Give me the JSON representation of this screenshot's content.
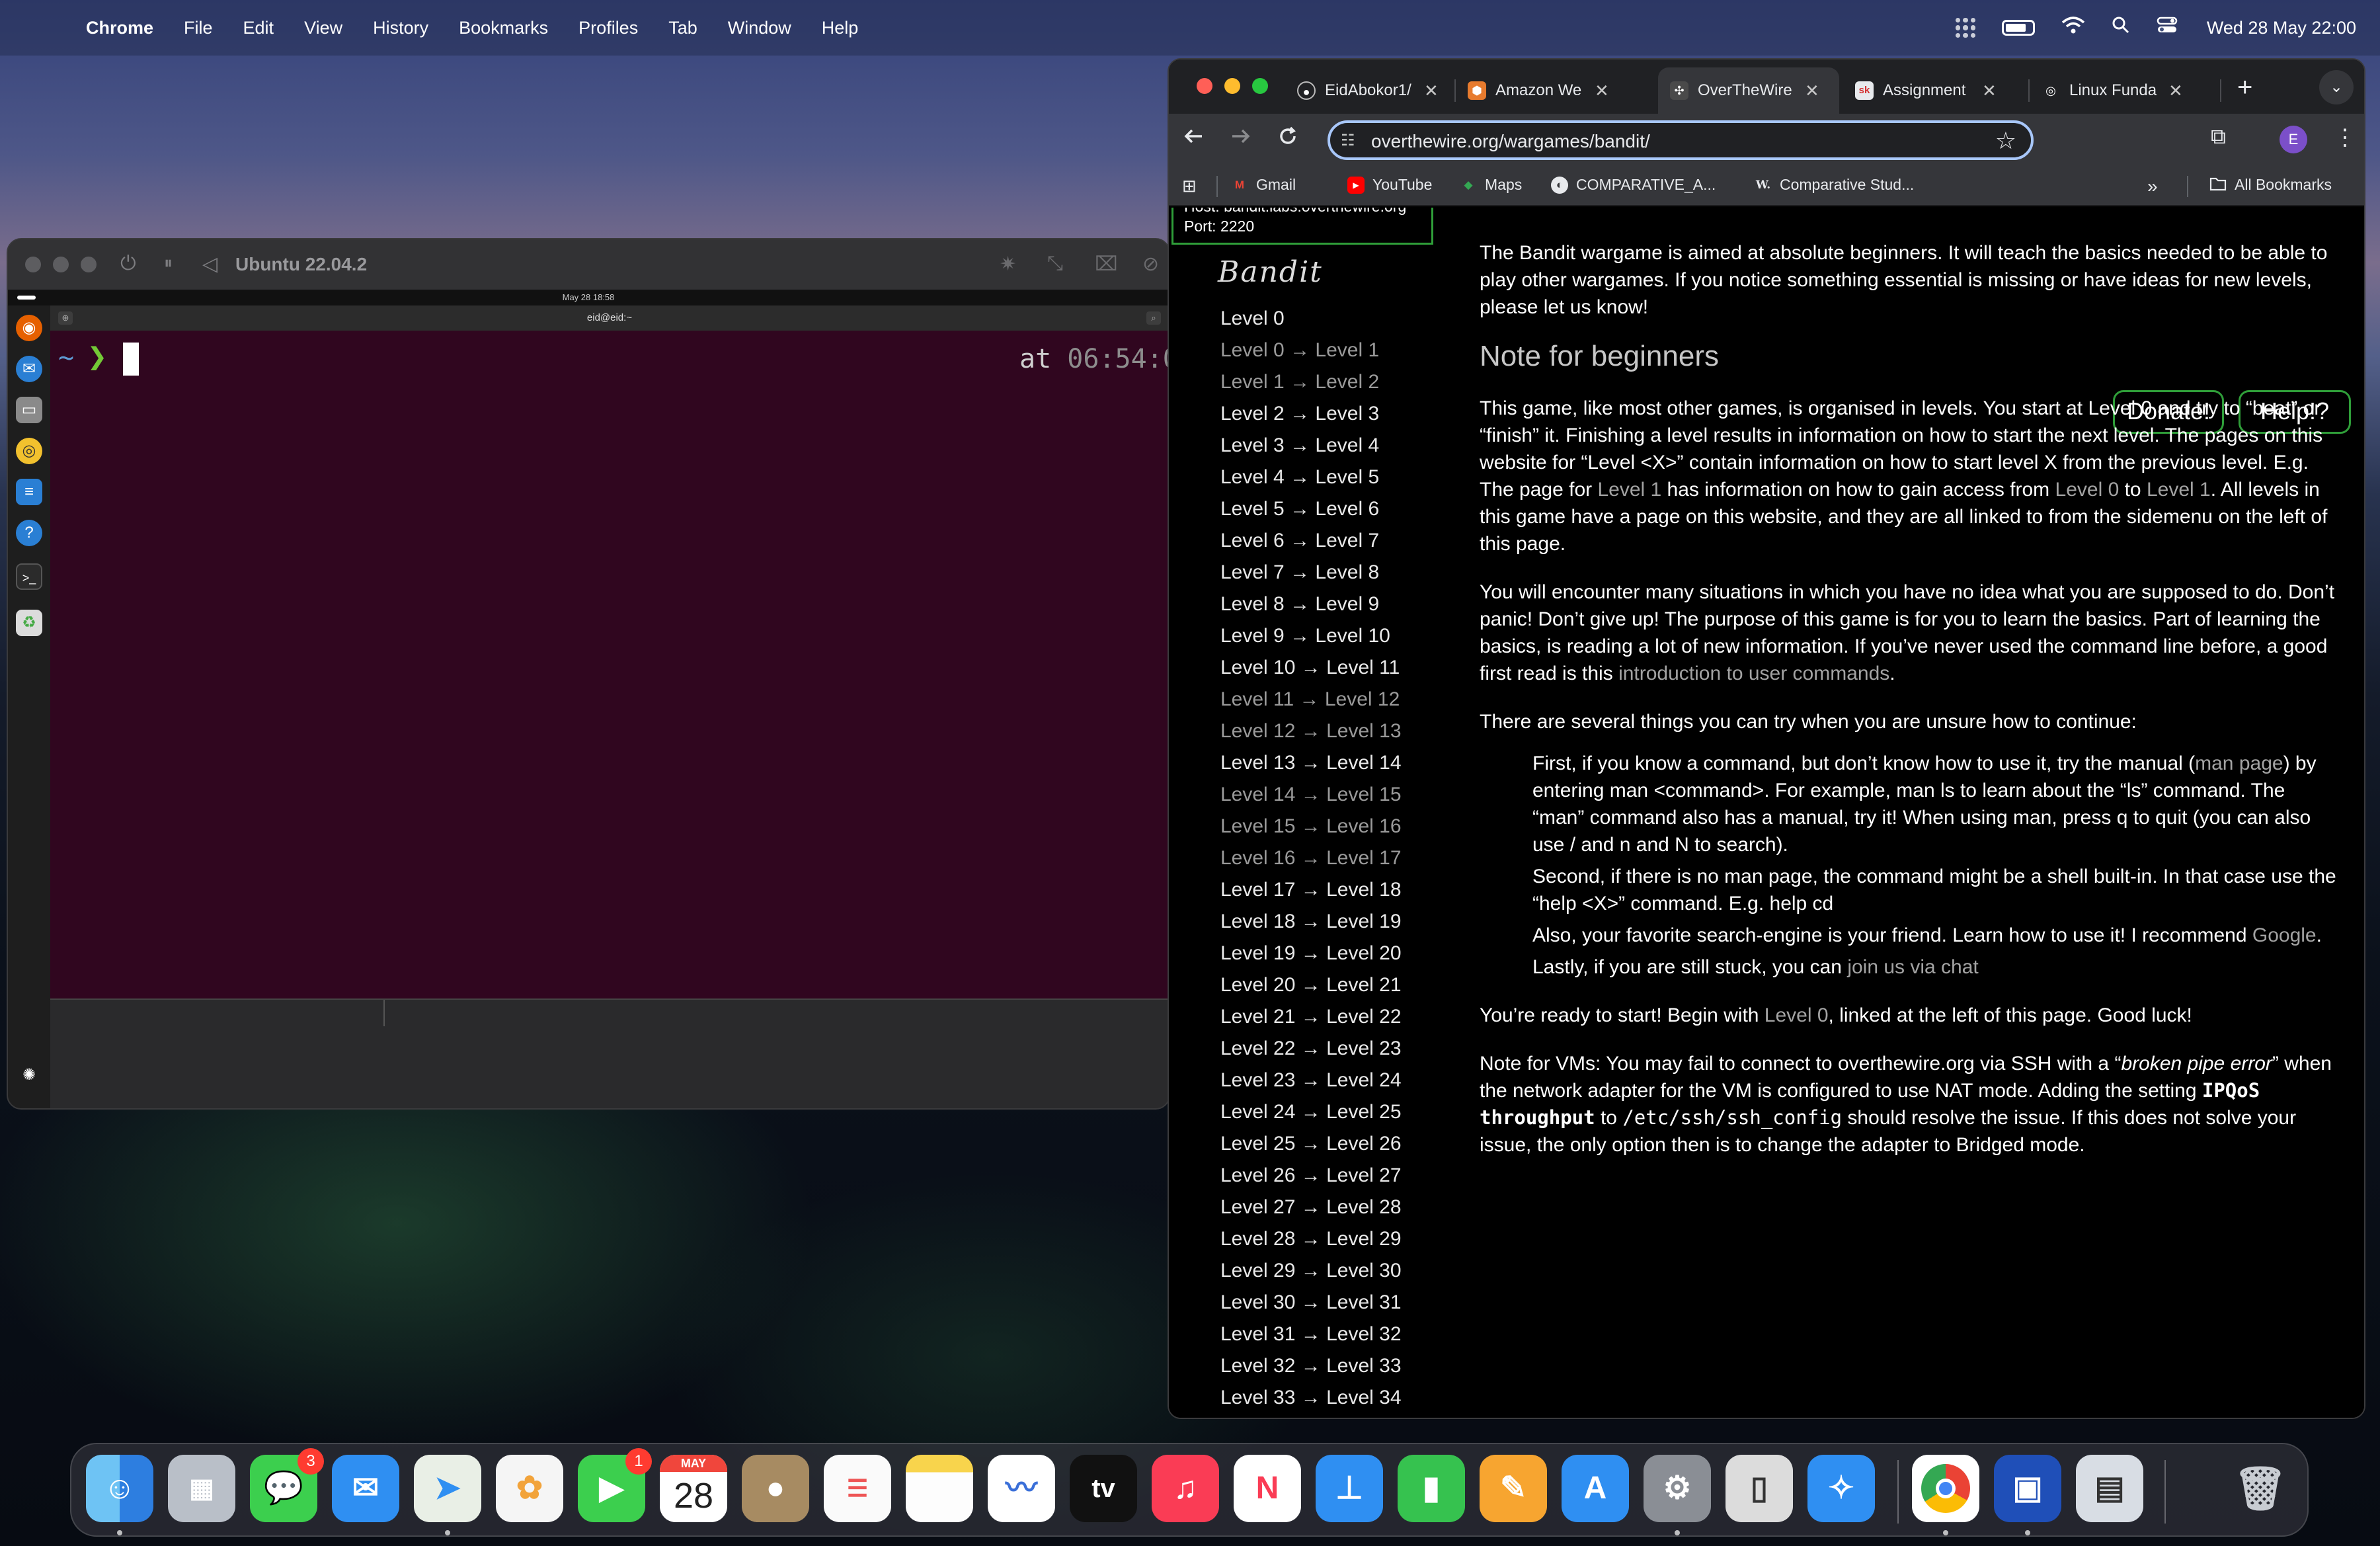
{
  "menubar": {
    "app_name": "Chrome",
    "menus": [
      "File",
      "Edit",
      "View",
      "History",
      "Bookmarks",
      "Profiles",
      "Tab",
      "Window",
      "Help"
    ],
    "clock": "Wed 28 May  22:00"
  },
  "vm": {
    "title": "Ubuntu 22.04.2",
    "ubuntu_clock": "May 28  18:58",
    "terminal_title": "eid@eid:~",
    "prompt_tilde": "~",
    "prompt_arrow": "❯",
    "right_prompt_at": "at",
    "right_prompt_time": "06:54:0"
  },
  "chrome": {
    "tabs": [
      {
        "label": "EidAbokor1/",
        "icon_name": "github-icon"
      },
      {
        "label": "Amazon We",
        "icon_name": "aws-icon"
      },
      {
        "label": "OverTheWire",
        "icon_name": "overthewire-icon"
      },
      {
        "label": "Assignment",
        "icon_name": "assignment-sk-icon"
      },
      {
        "label": "Linux Funda",
        "icon_name": "globe-icon"
      }
    ],
    "url": "overthewire.org/wargames/bandit/",
    "profile_initial": "E",
    "bookmarks": [
      {
        "label": "Gmail",
        "icon_name": "gmail-icon"
      },
      {
        "label": "YouTube",
        "icon_name": "youtube-icon"
      },
      {
        "label": "Maps",
        "icon_name": "maps-icon"
      },
      {
        "label": "COMPARATIVE_A...",
        "icon_name": "globe-icon"
      },
      {
        "label": "Comparative Stud...",
        "icon_name": "w-icon"
      }
    ],
    "all_bookmarks": "All Bookmarks"
  },
  "page": {
    "conn_host": "Host: bandit.labs.overthewire.org",
    "conn_port": "Port: 2220",
    "logo_text": "Bandit",
    "sidemenu": [
      "Level 0",
      "Level 0 → Level 1",
      "Level 1 → Level 2",
      "Level 2 → Level 3",
      "Level 3 → Level 4",
      "Level 4 → Level 5",
      "Level 5 → Level 6",
      "Level 6 → Level 7",
      "Level 7 → Level 8",
      "Level 8 → Level 9",
      "Level 9 → Level 10",
      "Level 10 → Level 11",
      "Level 11 → Level 12",
      "Level 12 → Level 13",
      "Level 13 → Level 14",
      "Level 14 → Level 15",
      "Level 15 → Level 16",
      "Level 16 → Level 17",
      "Level 17 → Level 18",
      "Level 18 → Level 19",
      "Level 19 → Level 20",
      "Level 20 → Level 21",
      "Level 21 → Level 22",
      "Level 22 → Level 23",
      "Level 23 → Level 24",
      "Level 24 → Level 25",
      "Level 25 → Level 26",
      "Level 26 → Level 27",
      "Level 27 → Level 28",
      "Level 28 → Level 29",
      "Level 29 → Level 30",
      "Level 30 → Level 31",
      "Level 31 → Level 32",
      "Level 32 → Level 33",
      "Level 33 → Level 34"
    ],
    "intro": "The Bandit wargame is aimed at absolute beginners. It will teach the basics needed to be able to play other wargames. If you notice something essential is missing or have ideas for new levels, please let us know!",
    "donate": "Donate!",
    "help": "Help!?",
    "heading": "Note for beginners",
    "p1a": "This game, like most other games, is organised in levels. You start at Level 0 and try to “beat” or “finish” it. Finishing a level results in information on how to start the next level. The pages on this website for “Level <X>” contain information on how to start level X from the previous level. E.g. The page for ",
    "p1_link1": "Level 1",
    "p1b": " has information on how to gain access from ",
    "p1_link2": "Level 0",
    "p1c": " to ",
    "p1_link3": "Level 1",
    "p1d": ". All levels in this game have a page on this website, and they are all linked to from the sidemenu on the left of this page.",
    "p2a": "You will encounter many situations in which you have no idea what you are supposed to do. Don’t panic! Don’t give up! The purpose of this game is for you to learn the basics. Part of learning the basics, is reading a lot of new information. If you’ve never used the command line before, a good first read is this ",
    "p2_link": "introduction to user commands",
    "p2b": ".",
    "p3": "There are several things you can try when you are unsure how to continue:",
    "tip1a": "First, if you know a command, but don’t know how to use it, try the manual (",
    "tip1_link": "man page",
    "tip1b": ") by entering man <command>. For example, man ls to learn about the “ls” command. The “man” command also has a manual, try it! When using man, press q to quit (you can also use / and n and N to search).",
    "tip2": "Second, if there is no man page, the command might be a shell built-in. In that case use the “help <X>” command. E.g. help cd",
    "tip3a": "Also, your favorite search-engine is your friend. Learn how to use it! I recommend ",
    "tip3_link": "Google",
    "tip3b": ".",
    "tip4a": "Lastly, if you are still stuck, you can ",
    "tip4_link": "join us via chat",
    "p4a": "You’re ready to start! Begin with ",
    "p4_link": "Level 0",
    "p4b": ", linked at the left of this page. Good luck!",
    "p5a": "Note for VMs: You may fail to connect to overthewire.org via SSH with a “",
    "p5_italic": "broken pipe error",
    "p5b": "” when the network adapter for the VM is configured to use NAT mode. Adding the setting ",
    "p5_code1": "IPQoS throughput",
    "p5c": " to ",
    "p5_code2": "/etc/ssh/ssh_config",
    "p5d": " should resolve the issue. If this does not solve your issue, the only option then is to change the adapter to Bridged mode."
  },
  "dock": {
    "calendar_month": "MAY",
    "calendar_day": "28",
    "messages_badge": "3",
    "facetime_badge": "1",
    "tv_label": "tv",
    "apps": [
      "finder-icon",
      "launchpad-icon",
      "messages-icon",
      "mail-icon",
      "maps-icon",
      "photos-icon",
      "facetime-icon",
      "calendar-icon",
      "contacts-icon",
      "reminders-icon",
      "notes-icon",
      "freeform-icon",
      "appletv-icon",
      "music-icon",
      "news-icon",
      "keynote-icon",
      "numbers-icon",
      "pages-icon",
      "appstore-icon",
      "system-settings-icon",
      "iphone-mirroring-icon",
      "safari-icon",
      "chrome-icon",
      "screen-sharing-icon",
      "preview-icon",
      "trash-icon"
    ]
  }
}
